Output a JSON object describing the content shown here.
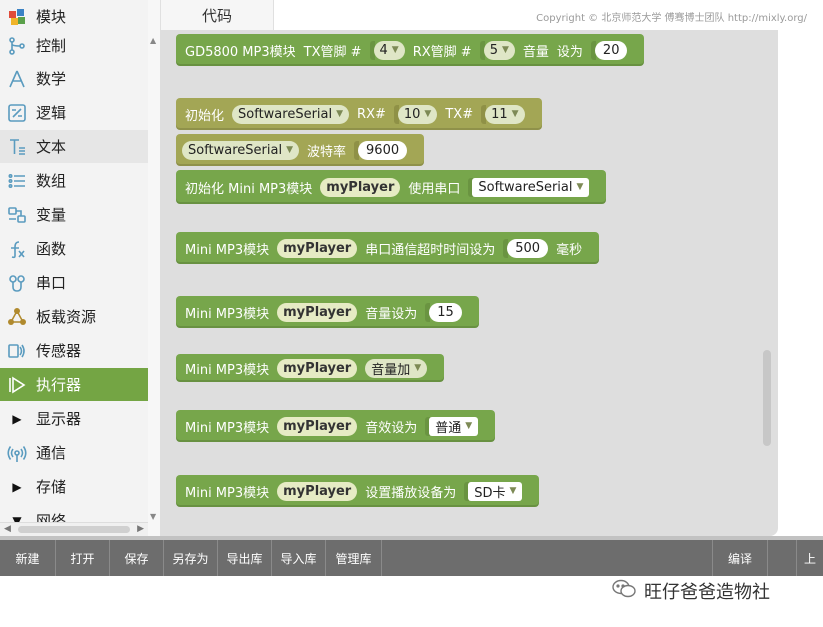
{
  "sidebar": {
    "items": [
      {
        "label": "模块",
        "icon": "puzzle-icon",
        "state": "title"
      },
      {
        "label": "控制",
        "icon": "branch-icon",
        "state": "normal"
      },
      {
        "label": "数学",
        "icon": "compass-icon",
        "state": "normal"
      },
      {
        "label": "逻辑",
        "icon": "logic-icon",
        "state": "normal"
      },
      {
        "label": "文本",
        "icon": "text-icon",
        "state": "hover"
      },
      {
        "label": "数组",
        "icon": "list-icon",
        "state": "normal"
      },
      {
        "label": "变量",
        "icon": "variable-icon",
        "state": "normal"
      },
      {
        "label": "函数",
        "icon": "function-icon",
        "state": "normal"
      },
      {
        "label": "串口",
        "icon": "serial-icon",
        "state": "normal"
      },
      {
        "label": "板载资源",
        "icon": "board-icon",
        "state": "normal"
      },
      {
        "label": "传感器",
        "icon": "sensor-icon",
        "state": "normal"
      },
      {
        "label": "执行器",
        "icon": "actuator-icon",
        "state": "active"
      },
      {
        "label": "显示器",
        "icon": "triangle-right-icon",
        "state": "normal"
      },
      {
        "label": "通信",
        "icon": "signal-icon",
        "state": "normal"
      },
      {
        "label": "存储",
        "icon": "triangle-right-icon",
        "state": "normal"
      },
      {
        "label": "网络",
        "icon": "triangle-down-icon",
        "state": "normal"
      }
    ]
  },
  "tabs": {
    "code": "代码"
  },
  "copyright": "Copyright © 北京师范大学 傅骞博士团队 http://mixly.org/",
  "blocks": {
    "gd5800": {
      "t1": "GD5800 MP3模块",
      "t2": "TX管脚 #",
      "tx": "4",
      "t3": "RX管脚 #",
      "rx": "5",
      "t4": "音量",
      "t5": "设为",
      "vol": "20"
    },
    "init_ss": {
      "t1": "初始化",
      "type": "SoftwareSerial",
      "t2": "RX#",
      "rx": "10",
      "t3": "TX#",
      "tx": "11"
    },
    "baud": {
      "type": "SoftwareSerial",
      "t1": "波特率",
      "val": "9600"
    },
    "init_mp3": {
      "t1": "初始化 Mini MP3模块",
      "var": "myPlayer",
      "t2": "使用串口",
      "port": "SoftwareSerial"
    },
    "timeout": {
      "t1": "Mini MP3模块",
      "var": "myPlayer",
      "t2": "串口通信超时时间设为",
      "val": "500",
      "unit": "毫秒"
    },
    "volume": {
      "t1": "Mini MP3模块",
      "var": "myPlayer",
      "t2": "音量设为",
      "val": "15"
    },
    "volup": {
      "t1": "Mini MP3模块",
      "var": "myPlayer",
      "op": "音量加"
    },
    "eq": {
      "t1": "Mini MP3模块",
      "var": "myPlayer",
      "t2": "音效设为",
      "val": "普通"
    },
    "device": {
      "t1": "Mini MP3模块",
      "var": "myPlayer",
      "t2": "设置播放设备为",
      "val": "SD卡"
    }
  },
  "toolbar": {
    "new": "新建",
    "open": "打开",
    "save": "保存",
    "save_as": "另存为",
    "export_lib": "导出库",
    "import_lib": "导入库",
    "manage_lib": "管理库",
    "compile": "编译",
    "upload": "上"
  },
  "watermark": "旺仔爸爸造物社"
}
